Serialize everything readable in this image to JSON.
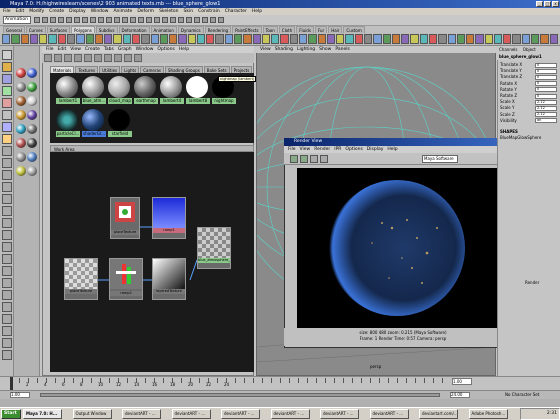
{
  "window": {
    "title": "Maya 7.0: H:/highwireslearn/scenes\\2 903 animated texts.mb --- blue_sphere_glow1"
  },
  "menubar": [
    "File",
    "Edit",
    "Modify",
    "Create",
    "Display",
    "Window",
    "Animate",
    "Deform",
    "Skeleton",
    "Skin",
    "Constrain",
    "Character",
    "Help"
  ],
  "status": {
    "mode": "Animation"
  },
  "shelf_tabs": [
    "General",
    "Curves",
    "Surfaces",
    "Polygons",
    "Subdivs",
    "Deformation",
    "Animation",
    "Dynamics",
    "Rendering",
    "PaintEffects",
    "Toon",
    "Cloth",
    "Fluids",
    "Fur",
    "Hair",
    "Custom"
  ],
  "hypershade": {
    "menu": [
      "File",
      "Edit",
      "View",
      "Create",
      "Tabs",
      "Graph",
      "Window",
      "Options",
      "Help"
    ],
    "tabs": [
      "Materials",
      "Textures",
      "Utilities",
      "Lights",
      "Cameras",
      "Shading Groups",
      "Bake Sets",
      "Projects"
    ],
    "swatches_row1": [
      "lambert1",
      "blue_atm...",
      "cloud_map",
      "earthmap",
      "lambert4",
      "lambert8",
      "nightmap"
    ],
    "tooltip": "nightmap (lambert)",
    "swatches_row2": [
      "particleCl...",
      "shaderGl...",
      "starfield"
    ],
    "work_area": "Work Area",
    "nodes": [
      "placeTexture",
      "ramp1",
      "blue_atmosphere_glow",
      "placeTexture",
      "ramp2",
      "layeredTexture"
    ]
  },
  "viewport": {
    "menu": [
      "View",
      "Shading",
      "Lighting",
      "Show",
      "Panels"
    ],
    "label": "persp"
  },
  "render_view": {
    "title": "Render View",
    "menu": [
      "File",
      "View",
      "Render",
      "IPR",
      "Options",
      "Display",
      "Help"
    ],
    "renderer": "Maya Software",
    "stats_line1": "size: 800 480 zoom: 0.215      (Maya Software)",
    "stats_line2": "Frame: 1       Render Time: 0:57       Camera: persp"
  },
  "channel_box": {
    "menu": [
      "Channels",
      "Object"
    ],
    "object": "blue_sphere_glow1",
    "attrs": [
      {
        "name": "Translate X",
        "value": "0"
      },
      {
        "name": "Translate Y",
        "value": "0"
      },
      {
        "name": "Translate Z",
        "value": "0"
      },
      {
        "name": "Rotate X",
        "value": "0"
      },
      {
        "name": "Rotate Y",
        "value": "0"
      },
      {
        "name": "Rotate Z",
        "value": "0"
      },
      {
        "name": "Scale X",
        "value": "2.12"
      },
      {
        "name": "Scale Y",
        "value": "2.12"
      },
      {
        "name": "Scale Z",
        "value": "2.12"
      },
      {
        "name": "Visibility",
        "value": "on"
      }
    ],
    "shapes_label": "SHAPES",
    "shape_name": "BlueMapGlowSphere",
    "render_label": "Render"
  },
  "timeline": {
    "ticks": [
      "2",
      "4",
      "6",
      "8",
      "10",
      "12",
      "14",
      "16",
      "18",
      "20",
      "22",
      "24"
    ],
    "current_frame": "1.00",
    "start": "1.00",
    "end": "24.00",
    "char_set": "No Character Set"
  },
  "taskbar": {
    "start": "Start",
    "items": [
      "Maya 7.0: H...",
      "Output Window",
      "deviantART - ...",
      "deviantART - ...",
      "deviantART - ...",
      "deviantART - ...",
      "deviantART - ...",
      "deviantART - ...",
      "deviantart.com/...",
      "Adobe Photosh..."
    ],
    "clock": "2:31"
  },
  "colors": {
    "titlebar": "#0a246a",
    "maya_bg": "#c6c6c6",
    "grid": "#5ad4c8"
  }
}
